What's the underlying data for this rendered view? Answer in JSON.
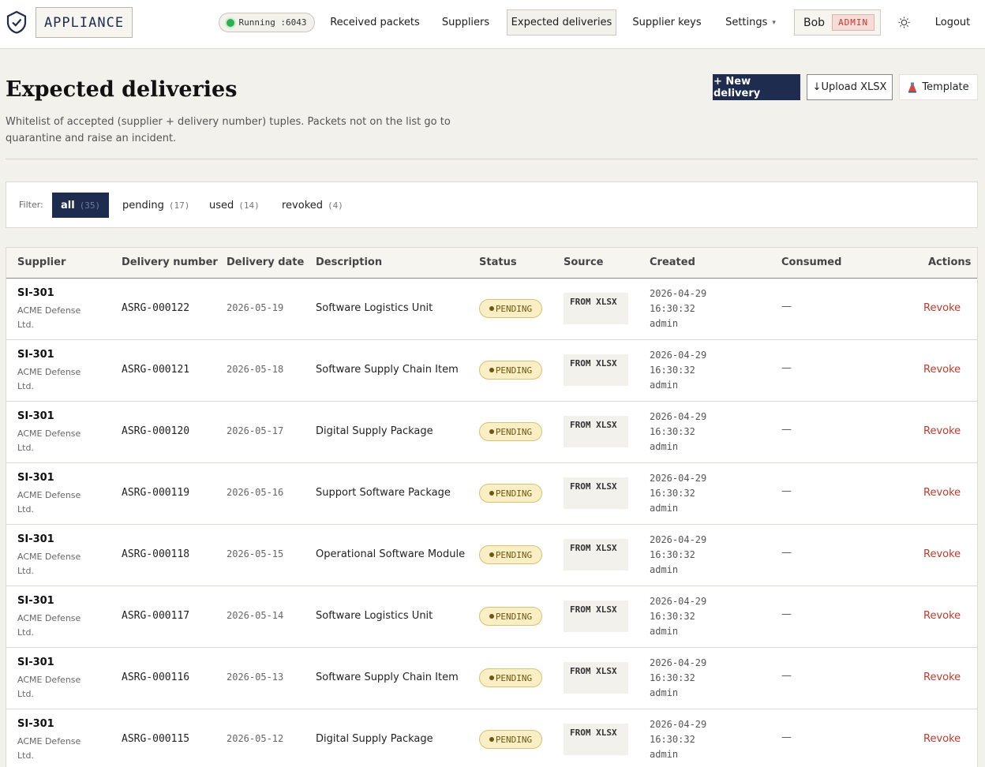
{
  "brand": {
    "name": "APPLIANCE"
  },
  "status": {
    "text": "Running :6043",
    "indicator_color": "#2eae4d"
  },
  "nav": {
    "received_packets": "Received packets",
    "suppliers": "Suppliers",
    "expected_deliveries": "Expected deliveries",
    "supplier_keys": "Supplier keys",
    "settings": "Settings",
    "settings_caret": "▾",
    "logout": "Logout"
  },
  "user": {
    "name": "Bob",
    "role": "ADMIN"
  },
  "icons": {
    "logo": "shield-check-icon",
    "theme": "sun-icon",
    "upload": "download-arrow-icon",
    "template": "flask-icon"
  },
  "page": {
    "title": "Expected deliveries",
    "description": "Whitelist of accepted (supplier + delivery number) tuples. Packets not on the list go to quarantine and raise an incident."
  },
  "actions": {
    "new_delivery": "+ New delivery",
    "upload_xlsx": "↓Upload XLSX",
    "template": "Template"
  },
  "filter": {
    "label": "Filter:",
    "options": [
      {
        "label": "all",
        "count": "(35)"
      },
      {
        "label": "pending",
        "count": "(17)"
      },
      {
        "label": "used",
        "count": "(14)"
      },
      {
        "label": "revoked",
        "count": "(4)"
      }
    ],
    "active": "all"
  },
  "table": {
    "columns": [
      "Supplier",
      "Delivery number",
      "Delivery date",
      "Description",
      "Status",
      "Source",
      "Created",
      "Consumed",
      "Actions"
    ],
    "rows": [
      {
        "supplier_code": "SI-301",
        "supplier_name": "ACME Defense Ltd.",
        "delivery_number": "ASRG-000122",
        "delivery_date": "2026-05-19",
        "description": "Software Logistics Unit",
        "status": "PENDING",
        "source": "FROM XLSX",
        "created_date": "2026-04-29",
        "created_time": "16:30:32",
        "created_by": "admin",
        "consumed": "—",
        "action": "Revoke"
      },
      {
        "supplier_code": "SI-301",
        "supplier_name": "ACME Defense Ltd.",
        "delivery_number": "ASRG-000121",
        "delivery_date": "2026-05-18",
        "description": "Software Supply Chain Item",
        "status": "PENDING",
        "source": "FROM XLSX",
        "created_date": "2026-04-29",
        "created_time": "16:30:32",
        "created_by": "admin",
        "consumed": "—",
        "action": "Revoke"
      },
      {
        "supplier_code": "SI-301",
        "supplier_name": "ACME Defense Ltd.",
        "delivery_number": "ASRG-000120",
        "delivery_date": "2026-05-17",
        "description": "Digital Supply Package",
        "status": "PENDING",
        "source": "FROM XLSX",
        "created_date": "2026-04-29",
        "created_time": "16:30:32",
        "created_by": "admin",
        "consumed": "—",
        "action": "Revoke"
      },
      {
        "supplier_code": "SI-301",
        "supplier_name": "ACME Defense Ltd.",
        "delivery_number": "ASRG-000119",
        "delivery_date": "2026-05-16",
        "description": "Support Software Package",
        "status": "PENDING",
        "source": "FROM XLSX",
        "created_date": "2026-04-29",
        "created_time": "16:30:32",
        "created_by": "admin",
        "consumed": "—",
        "action": "Revoke"
      },
      {
        "supplier_code": "SI-301",
        "supplier_name": "ACME Defense Ltd.",
        "delivery_number": "ASRG-000118",
        "delivery_date": "2026-05-15",
        "description": "Operational Software Module",
        "status": "PENDING",
        "source": "FROM XLSX",
        "created_date": "2026-04-29",
        "created_time": "16:30:32",
        "created_by": "admin",
        "consumed": "—",
        "action": "Revoke"
      },
      {
        "supplier_code": "SI-301",
        "supplier_name": "ACME Defense Ltd.",
        "delivery_number": "ASRG-000117",
        "delivery_date": "2026-05-14",
        "description": "Software Logistics Unit",
        "status": "PENDING",
        "source": "FROM XLSX",
        "created_date": "2026-04-29",
        "created_time": "16:30:32",
        "created_by": "admin",
        "consumed": "—",
        "action": "Revoke"
      },
      {
        "supplier_code": "SI-301",
        "supplier_name": "ACME Defense Ltd.",
        "delivery_number": "ASRG-000116",
        "delivery_date": "2026-05-13",
        "description": "Software Supply Chain Item",
        "status": "PENDING",
        "source": "FROM XLSX",
        "created_date": "2026-04-29",
        "created_time": "16:30:32",
        "created_by": "admin",
        "consumed": "—",
        "action": "Revoke"
      },
      {
        "supplier_code": "SI-301",
        "supplier_name": "ACME Defense Ltd.",
        "delivery_number": "ASRG-000115",
        "delivery_date": "2026-05-12",
        "description": "Digital Supply Package",
        "status": "PENDING",
        "source": "FROM XLSX",
        "created_date": "2026-04-29",
        "created_time": "16:30:32",
        "created_by": "admin",
        "consumed": "—",
        "action": "Revoke"
      }
    ]
  },
  "colors": {
    "primary": "#1d2c4f",
    "danger": "#c0392b",
    "pending_bg": "#faeec5",
    "background": "#f3f1ec"
  }
}
